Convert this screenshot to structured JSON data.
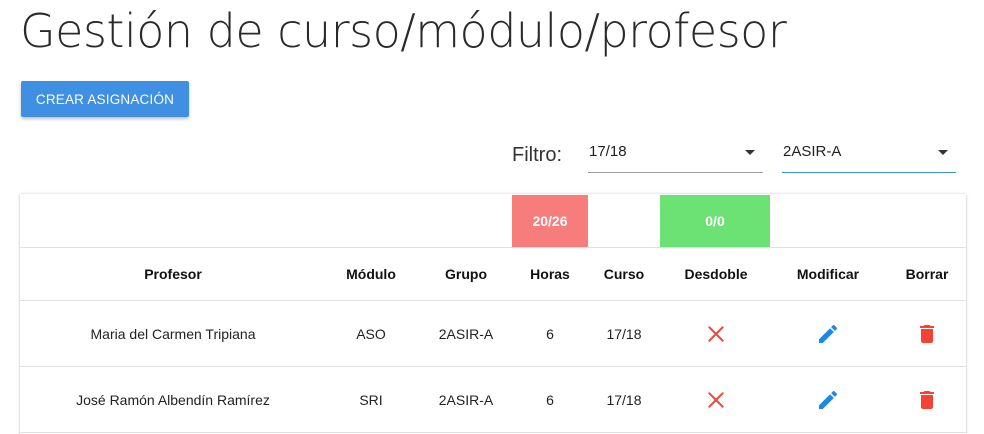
{
  "page": {
    "title": "Gestión de curso/módulo/profesor"
  },
  "toolbar": {
    "create_label": "CREAR ASIGNACIÓN"
  },
  "filter": {
    "label": "Filtro:",
    "course": {
      "value": "17/18"
    },
    "group": {
      "value": "2ASIR-A"
    }
  },
  "summary": {
    "hours": {
      "text": "20/26",
      "color": "#f77d7d"
    },
    "split": {
      "text": "0/0",
      "color": "#6ce275"
    }
  },
  "table": {
    "headers": {
      "professor": "Profesor",
      "module": "Módulo",
      "group": "Grupo",
      "hours": "Horas",
      "course": "Curso",
      "split": "Desdoble",
      "edit": "Modificar",
      "delete": "Borrar"
    },
    "rows": [
      {
        "professor": "Maria del Carmen Tripiana",
        "module": "ASO",
        "group": "2ASIR-A",
        "hours": "6",
        "course": "17/18",
        "split_icon": "close-icon",
        "edit_icon": "pencil-icon",
        "delete_icon": "trash-icon"
      },
      {
        "professor": "José Ramón Albendín Ramírez",
        "module": "SRI",
        "group": "2ASIR-A",
        "hours": "6",
        "course": "17/18",
        "split_icon": "close-icon",
        "edit_icon": "pencil-icon",
        "delete_icon": "trash-icon"
      }
    ]
  },
  "colors": {
    "primary": "#3f8fe3",
    "edit_icon": "#1e88e5",
    "delete_icon": "#f44336",
    "split_icon": "#f44336"
  }
}
